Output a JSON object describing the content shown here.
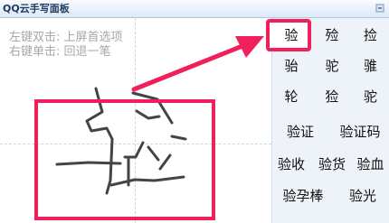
{
  "window": {
    "title": "QQ云手写面板"
  },
  "hints": {
    "left_double_click": "左键双击: 上屏首选项",
    "right_click": "右键单击: 回退一笔"
  },
  "candidates": {
    "row1": [
      "验",
      "殓",
      "捡"
    ],
    "row2": [
      "骀",
      "驼",
      "骓"
    ],
    "row3": [
      "轮",
      "猃",
      "驼"
    ],
    "row4": [
      "验证",
      "验证码"
    ],
    "row5": [
      "验收",
      "验货",
      "验血"
    ],
    "row6": [
      "验孕棒",
      "验光"
    ]
  },
  "colors": {
    "annotation": "#f0205d",
    "stroke": "#444444"
  }
}
